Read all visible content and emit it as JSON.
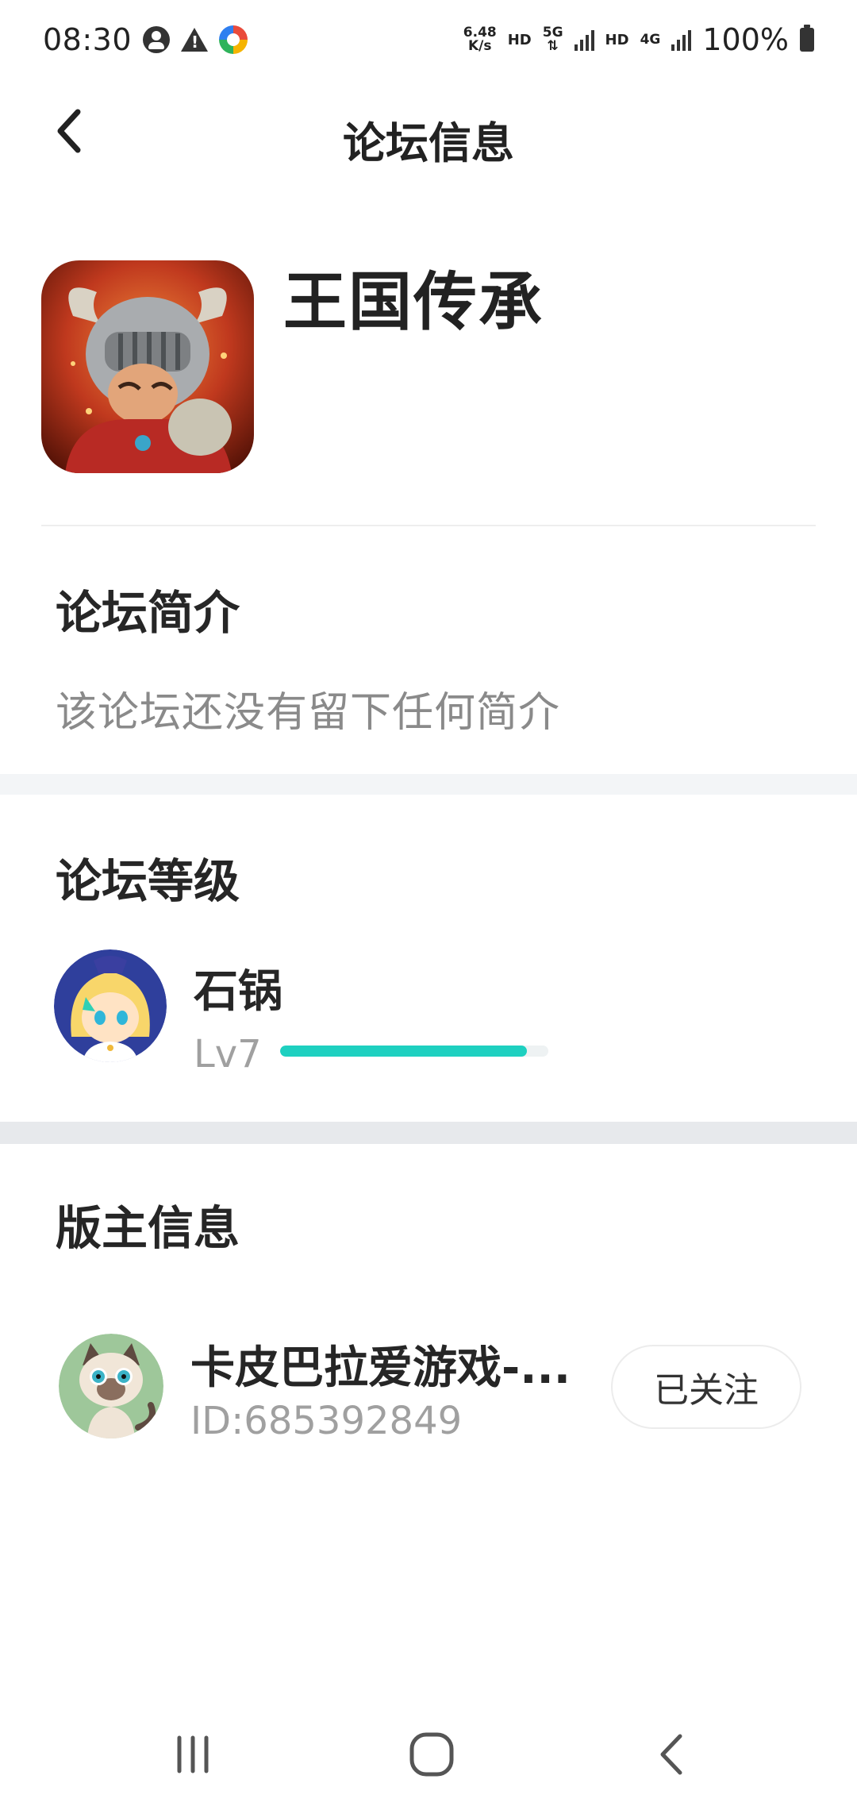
{
  "status_bar": {
    "time": "08:30",
    "speed_value": "6.48",
    "speed_unit": "K/s",
    "hd_1": "HD",
    "net_1": "5G",
    "hd_2": "HD",
    "net_2": "4G",
    "battery": "100%"
  },
  "header": {
    "title": "论坛信息",
    "back_icon": "chevron-left-icon"
  },
  "forum": {
    "name": "王国传承",
    "icon": "knight-game-icon"
  },
  "intro": {
    "title": "论坛简介",
    "text": "该论坛还没有留下任何简介"
  },
  "level": {
    "title": "论坛等级",
    "name": "石锅",
    "label": "Lv7",
    "progress": 0.92,
    "accent": "#1ed0c0"
  },
  "moderator": {
    "title": "版主信息",
    "name": "卡皮巴拉爱游戏-...",
    "id": "ID:685392849",
    "follow_label": "已关注"
  },
  "nav": {
    "recents_icon": "recents-icon",
    "home_icon": "home-icon",
    "back_icon": "back-icon"
  }
}
